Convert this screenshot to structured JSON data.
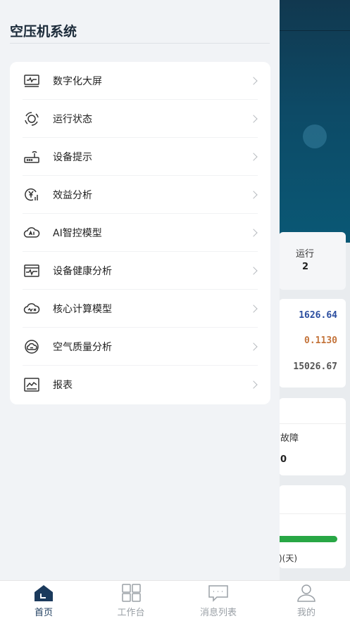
{
  "drawer": {
    "title": "空压机系统",
    "items": [
      {
        "label": "数字化大屏",
        "icon": "monitor-icon"
      },
      {
        "label": "运行状态",
        "icon": "refresh-cycle-icon"
      },
      {
        "label": "设备提示",
        "icon": "router-icon"
      },
      {
        "label": "效益分析",
        "icon": "yuan-chart-icon"
      },
      {
        "label": "AI智控模型",
        "icon": "ai-cloud-icon"
      },
      {
        "label": "设备健康分析",
        "icon": "heartbeat-monitor-icon"
      },
      {
        "label": "核心计算模型",
        "icon": "cloud-calc-icon"
      },
      {
        "label": "空气质量分析",
        "icon": "air-cloud-icon"
      },
      {
        "label": "报表",
        "icon": "line-chart-icon"
      }
    ]
  },
  "background": {
    "status_label": "运行",
    "status_value": "2",
    "values": [
      "1626.64",
      "0.1130",
      "15026.67"
    ],
    "fault_label": "故障",
    "fault_value": "0",
    "health_label": ")(天)"
  },
  "tabbar": {
    "tabs": [
      {
        "label": "首页",
        "icon": "home-icon",
        "active": true
      },
      {
        "label": "工作台",
        "icon": "grid-icon",
        "active": false
      },
      {
        "label": "消息列表",
        "icon": "message-icon",
        "active": false
      },
      {
        "label": "我的",
        "icon": "user-icon",
        "active": false
      }
    ]
  },
  "colors": {
    "accent": "#1b3a5c",
    "header_bg": "#0d4a66",
    "value_blue": "#2b4ea0",
    "value_orange": "#c4743b",
    "health_green": "#28a745"
  }
}
